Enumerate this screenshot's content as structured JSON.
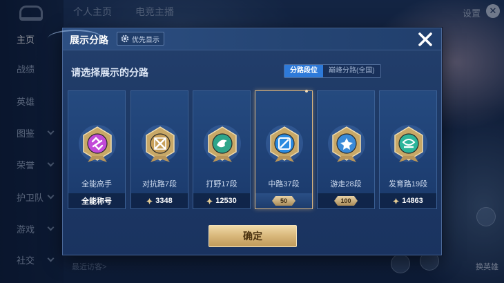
{
  "app": {
    "top_tabs": [
      "个人主页",
      "电竞主播"
    ],
    "settings_label": "设置",
    "sidebar_items": [
      {
        "label": "主页",
        "active": true,
        "chevron": false
      },
      {
        "label": "战绩",
        "active": false,
        "chevron": false
      },
      {
        "label": "英雄",
        "active": false,
        "chevron": false
      },
      {
        "label": "图鉴",
        "active": false,
        "chevron": true
      },
      {
        "label": "荣誉",
        "active": false,
        "chevron": true
      },
      {
        "label": "护卫队",
        "active": false,
        "chevron": true
      },
      {
        "label": "游戏",
        "active": false,
        "chevron": true
      },
      {
        "label": "社交",
        "active": false,
        "chevron": true
      }
    ],
    "bottom_hint": "最近访客>",
    "swap_hero_label": "换英雄"
  },
  "dialog": {
    "title": "展示分路",
    "priority_label": "优先显示",
    "prompt": "请选择展示的分路",
    "toggle": {
      "options": [
        "分路段位",
        "巅峰分路(全国)"
      ],
      "active_index": 0
    },
    "cards": [
      {
        "label": "全能高手",
        "foot": "全能称号",
        "foot_type": "text",
        "badge_color": "#c24ad8",
        "selected": false
      },
      {
        "label": "对抗路7段",
        "foot": "3348",
        "foot_type": "points",
        "badge_color": "#c8a05a",
        "selected": false
      },
      {
        "label": "打野17段",
        "foot": "12530",
        "foot_type": "points",
        "badge_color": "#2ea58a",
        "selected": false
      },
      {
        "label": "中路37段",
        "foot": "50",
        "foot_type": "rank",
        "badge_color": "#2a8ae0",
        "selected": true
      },
      {
        "label": "游走28段",
        "foot": "100",
        "foot_type": "rank",
        "badge_color": "#3a8ad8",
        "selected": false
      },
      {
        "label": "发育路19段",
        "foot": "14863",
        "foot_type": "points",
        "badge_color": "#2cb59a",
        "selected": false
      }
    ],
    "confirm_label": "确定"
  },
  "colors": {
    "accent_blue": "#2e7ad9",
    "gold": "#d8b77a",
    "dialog_bg": "#1d3864"
  }
}
